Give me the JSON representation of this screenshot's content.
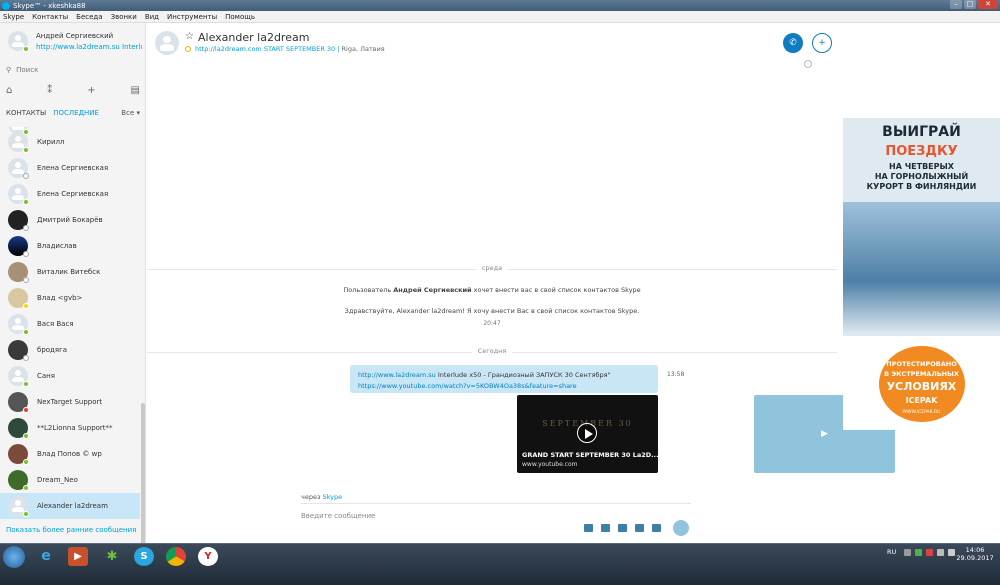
{
  "titlebar": {
    "title": "Skype™ - xkeshka88"
  },
  "menu": [
    "Skype",
    "Контакты",
    "Беседа",
    "Звонки",
    "Вид",
    "Инструменты",
    "Помощь"
  ],
  "profile": {
    "name": "Андрей Сергиевский",
    "mood": "http://www.la2dream.su Interlude x50 - Гран..."
  },
  "search": {
    "placeholder": "Поиск"
  },
  "tabs": {
    "contacts": "КОНТАКТЫ",
    "recent": "ПОСЛЕДНИЕ",
    "filter": "Все ▾"
  },
  "contacts": [
    {
      "name": "",
      "status": "online"
    },
    {
      "name": "Кирилл",
      "status": "online"
    },
    {
      "name": "Елена Сергиевская",
      "status": "offline"
    },
    {
      "name": "Елена Сергиевская",
      "status": "online"
    },
    {
      "name": "Дмитрий Бокарёв",
      "status": "offline"
    },
    {
      "name": "Владислав",
      "status": "offline"
    },
    {
      "name": "Виталик Витебск",
      "status": "offline"
    },
    {
      "name": "Влад <gvb>",
      "status": "away"
    },
    {
      "name": "Вася Вася",
      "status": "online"
    },
    {
      "name": "бродяга",
      "status": "offline"
    },
    {
      "name": "Саня",
      "status": "online"
    },
    {
      "name": "NexTarget Support",
      "status": "busy"
    },
    {
      "name": "**L2Lionna Support**",
      "status": "online"
    },
    {
      "name": "Влад Попов © wp",
      "status": "online"
    },
    {
      "name": "Dream_Neo",
      "status": "online"
    },
    {
      "name": "Alexander la2dream",
      "status": "online"
    }
  ],
  "more_link": "Показать более ранние сообщения",
  "chat": {
    "name": "Alexander la2dream",
    "link": "http://la2dream.com START SEPTEMBER 30",
    "location": "Riga, Латвия"
  },
  "messages": {
    "day1": "среда",
    "sys1_pre": "Пользователь",
    "sys1_user": "Андрей Сергиевский",
    "sys1_post": "хочет внести вас в свой список контактов Skype",
    "sys2": "Здравствуйте, Alexander la2dream! Я хочу внести Вас в свой список контактов Skype.",
    "sys_time": "20:47",
    "day2": "Сегодня",
    "msg_link1": "http://www.la2dream.su",
    "msg_text": " Interlude x50 - Грандиозный ЗАПУСК 30 Сентября\"",
    "msg_link2": "https://www.youtube.com/watch?v=5KOBW4Oa38s&feature=share",
    "msg_time": "13:58",
    "video_art": "SEPTEMBER 30",
    "video_title": "GRAND START SEPTEMBER 30 La2D...",
    "video_site": "www.youtube.com"
  },
  "via": {
    "prefix": "через",
    "link": "Skype"
  },
  "compose": {
    "placeholder": "Введите сообщение"
  },
  "ad": {
    "h1": "ВЫИГРАЙ",
    "h2": "ПОЕЗДКУ",
    "h3a": "НА ЧЕТВЕРЫХ",
    "h3b": "НА ГОРНОЛЫЖНЫЙ",
    "h3c": "КУРОРТ В ФИНЛЯНДИИ",
    "b1": "ПРОТЕСТИРОВАНО",
    "b2": "В ЭКСТРЕМАЛЬНЫХ",
    "b3": "УСЛОВИЯХ",
    "b4": "ICEPAK",
    "b5": "WWW.ICEPAK.RU"
  },
  "taskbar": {
    "lang": "RU",
    "time": "14:06",
    "date": "29.09.2017"
  },
  "colors": {
    "accent": "#00a0d6",
    "call": "#0f7bc0",
    "bubble": "#c9e6f7"
  }
}
